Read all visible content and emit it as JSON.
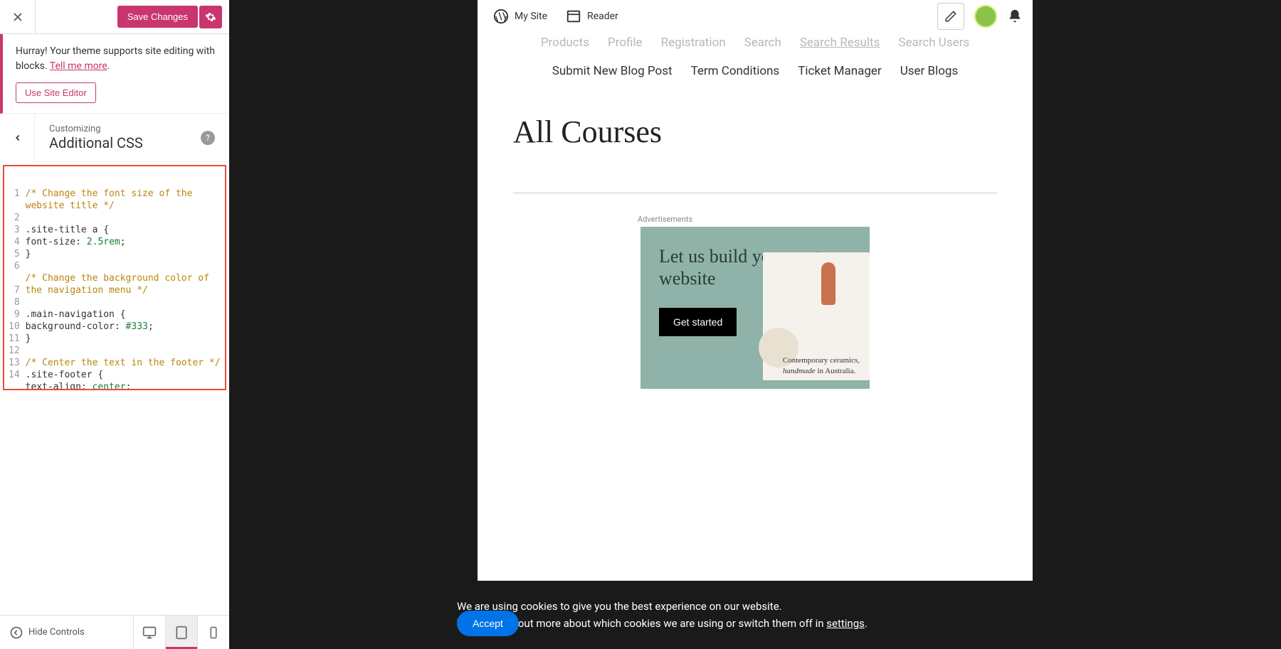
{
  "panel": {
    "save_label": "Save Changes",
    "notice_text": "Hurray! Your theme supports site editing with blocks. ",
    "notice_link": "Tell me more",
    "site_editor_btn": "Use Site Editor",
    "subtitle": "Customizing",
    "title": "Additional CSS",
    "hide_controls": "Hide Controls"
  },
  "code": {
    "lines": [
      "1",
      "2",
      "3",
      "4",
      "5",
      "6",
      "7",
      "8",
      "9",
      "10",
      "11",
      "12",
      "13",
      "14"
    ],
    "l1_comment": "/* Change the font size of the website title */",
    "l2_selector": ".site-title a",
    "l2_brace": " {",
    "l3_prop": "    font-size",
    "l3_val": "2.5rem",
    "l4": "}",
    "l6_comment": "/* Change the background color of the navigation menu */",
    "l7_selector": ".main-navigation",
    "l7_brace": " {",
    "l8_prop": "    background-color",
    "l8_val": "#333",
    "l9": "}",
    "l11_comment": "/* Center the text in the footer */",
    "l12_selector": ".site-footer",
    "l12_brace": " {",
    "l13_prop": "    text-align",
    "l13_val": "center",
    "l14": "}"
  },
  "wpbar": {
    "my_site": "My Site",
    "reader": "Reader"
  },
  "nav": {
    "items_row1": [
      "Products",
      "Profile",
      "Registration",
      "Search",
      "Search Results",
      "Search Users"
    ],
    "items_row2": [
      "Submit New Blog Post",
      "Term Conditions",
      "Ticket Manager",
      "User Blogs"
    ]
  },
  "page": {
    "title": "All Courses"
  },
  "ad": {
    "label": "Advertisements",
    "headline": "Let us build your custom website",
    "cta": "Get started",
    "caption1": "Contemporary ceramics,",
    "caption2": "handmade",
    "caption3": " in Australia."
  },
  "cookie": {
    "line1": "We are using cookies to give you the best experience on our website.",
    "line2a": "You can find out more about which cookies we are using or switch them off in ",
    "line2b": "settings",
    "accept": "Accept"
  }
}
